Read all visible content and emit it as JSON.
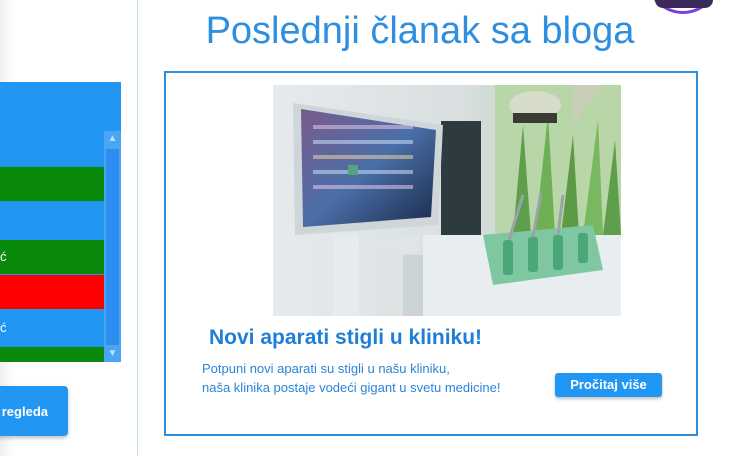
{
  "sidebar": {
    "rows": [
      {
        "label": "",
        "status": "blue"
      },
      {
        "label": "",
        "status": "green"
      },
      {
        "label": "",
        "status": "blue"
      },
      {
        "label": "ć",
        "status": "green"
      },
      {
        "label": "",
        "status": "red"
      },
      {
        "label": "ć",
        "status": "blue"
      },
      {
        "label": "",
        "status": "green"
      }
    ],
    "scroll_up_icon": "arrow-up-icon",
    "scroll_down_icon": "arrow-down-icon",
    "button_label": "regleda"
  },
  "section": {
    "title": "Poslednji članak sa bloga"
  },
  "post": {
    "image_alt": "dental-equipment-photo",
    "title": "Novi aparati stigli u kliniku!",
    "text_line1": "Potpuni novi aparati su stigli u našu kliniku,",
    "text_line2": "naša klinika postaje vodeći gigant u svetu medicine!",
    "read_more_label": "Pročitaj više"
  },
  "colors": {
    "accent": "#2196f3",
    "green": "#0a8a0a",
    "red": "#ff0000",
    "title": "#2e8fe0"
  }
}
